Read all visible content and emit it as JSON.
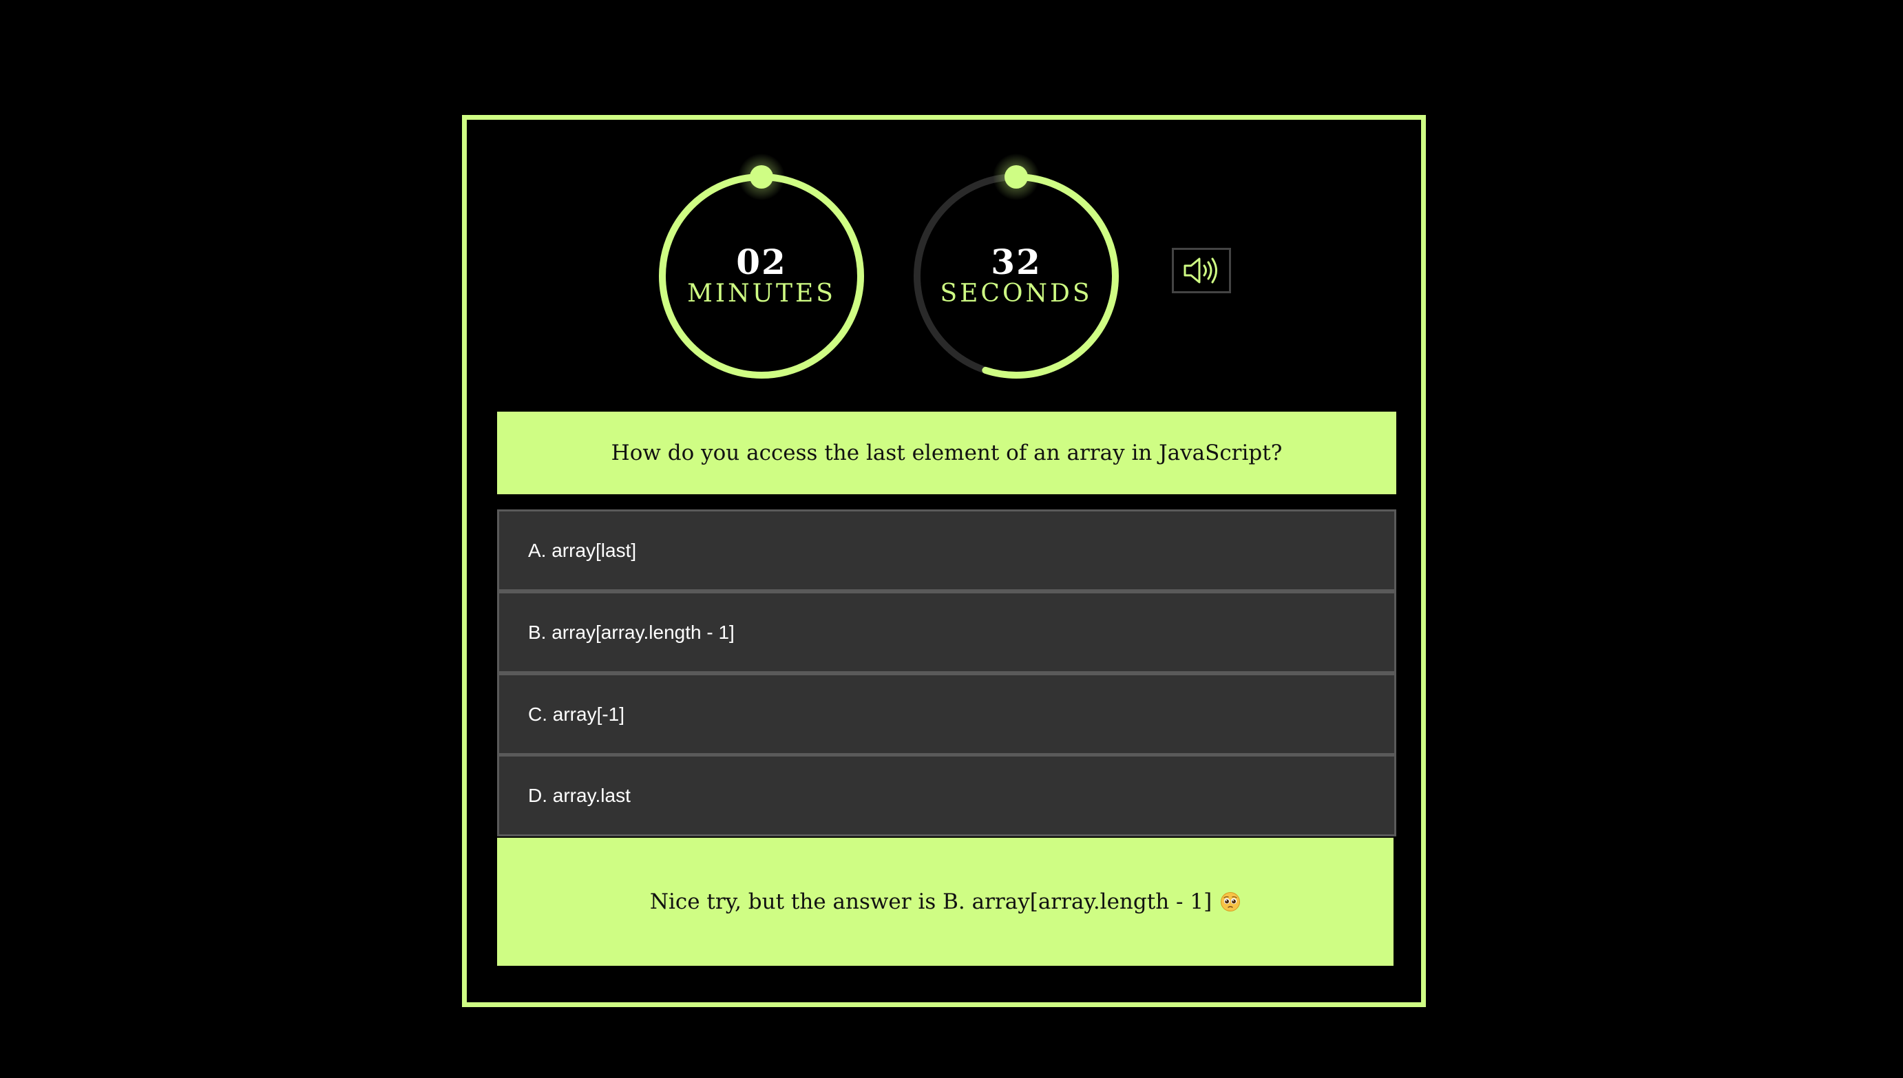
{
  "colors": {
    "accent": "#cffd84",
    "background": "#000000",
    "option_bg": "#333333",
    "track": "#2a2a2a"
  },
  "timers": {
    "minutes": {
      "value": "02",
      "label": "MINUTES",
      "progress": 1.0
    },
    "seconds": {
      "value": "32",
      "label": "SECONDS",
      "progress": 0.55
    }
  },
  "sound_button": {
    "icon": "speaker-volume-icon"
  },
  "question": {
    "text": "How do you access the last element of an array in JavaScript?"
  },
  "options": [
    {
      "label": "A. array[last]"
    },
    {
      "label": "B. array[array.length - 1]"
    },
    {
      "label": "C. array[-1]"
    },
    {
      "label": "D. array.last"
    }
  ],
  "feedback": {
    "text": "Nice try, but the answer is B. array[array.length - 1]",
    "icon": "pleading-face-emoji-icon"
  }
}
